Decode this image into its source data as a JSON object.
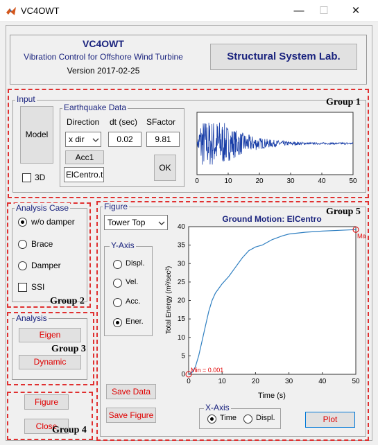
{
  "window": {
    "title": "VC4OWT",
    "minimize": "—",
    "maximize": "☐",
    "close": "✕"
  },
  "header": {
    "title": "VC4OWT",
    "subtitle": "Vibration Control for Offshore Wind Turbine",
    "version": "Version 2017-02-25",
    "lab_button": "Structural System Lab."
  },
  "input": {
    "frame_label": "Input",
    "group_label": "Group 1",
    "model_button": "Model",
    "three_d_label": "3D",
    "earthquake_label": "Earthquake Data",
    "direction_label": "Direction",
    "dt_label": "dt (sec)",
    "sfactor_label": "SFactor",
    "direction_value": "x dir",
    "dt_value": "0.02",
    "sfactor_value": "9.81",
    "acc_button": "Acc1",
    "file_value": "ElCentro.t",
    "ok_button": "OK",
    "mini_chart_ticks": [
      "0",
      "10",
      "20",
      "30",
      "40",
      "50"
    ]
  },
  "analysis_case": {
    "frame_label": "Analysis Case",
    "group_label": "Group 2",
    "options": [
      "w/o damper",
      "Brace",
      "Damper"
    ],
    "selected": 0,
    "ssi_label": "SSI"
  },
  "analysis": {
    "frame_label": "Analysis",
    "group_label": "Group 3",
    "eigen_button": "Eigen",
    "dynamic_button": "Dynamic"
  },
  "group4": {
    "group_label": "Group 4",
    "figure_button": "Figure",
    "close_button": "Close"
  },
  "figure": {
    "frame_label": "Figure",
    "group_label": "Group 5",
    "location_value": "Tower Top",
    "yaxis_label": "Y-Axis",
    "yaxis_options": [
      "Displ.",
      "Vel.",
      "Acc.",
      "Ener."
    ],
    "yaxis_selected": 3,
    "save_data_button": "Save Data",
    "save_figure_button": "Save Figure",
    "xaxis_label": "X-Axis",
    "xaxis_options": [
      "Time",
      "Displ."
    ],
    "xaxis_selected": 0,
    "plot_button": "Plot"
  },
  "chart_data": {
    "type": "line",
    "title": "Ground Motion: ElCentro",
    "xlabel": "Time (s)",
    "ylabel": "Total Energy (m²/sec²)",
    "xlim": [
      0,
      50
    ],
    "ylim": [
      0,
      40
    ],
    "xticks": [
      0,
      10,
      20,
      30,
      40,
      50
    ],
    "yticks": [
      0,
      5,
      10,
      15,
      20,
      25,
      30,
      35,
      40
    ],
    "min_annotation": "Min = 0.001",
    "max_annotation": "Ma",
    "series": [
      {
        "color": "#2f7fc1",
        "x": [
          0,
          1,
          2,
          3,
          4,
          5,
          6,
          7,
          8,
          10,
          12,
          14,
          16,
          18,
          20,
          22,
          25,
          28,
          30,
          35,
          40,
          45,
          50
        ],
        "y": [
          0.001,
          0.5,
          2,
          5,
          9,
          13,
          17,
          20,
          22,
          24.5,
          26.5,
          29,
          31.5,
          33.5,
          34.5,
          35,
          36.5,
          37.5,
          38,
          38.5,
          38.8,
          39,
          39.2
        ]
      }
    ],
    "mini_series": {
      "xlim": [
        0,
        50
      ],
      "samples": 500
    }
  }
}
